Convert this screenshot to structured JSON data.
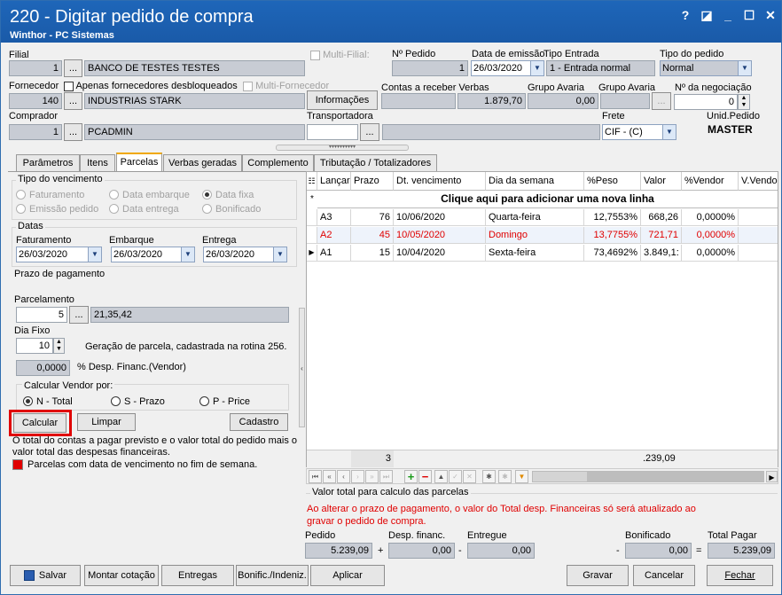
{
  "window": {
    "title": "220 - Digitar pedido de compra",
    "subtitle": "Winthor - PC Sistemas",
    "help": "?",
    "min": "_",
    "max": "☐",
    "close": "✕",
    "restore": "◪"
  },
  "header": {
    "filial_label": "Filial",
    "filial_code": "1",
    "filial_name": "BANCO DE TESTES TESTES",
    "multi_filial": "Multi-Filial:",
    "num_pedido_label": "Nº Pedido",
    "num_pedido": "1",
    "data_emissao_label": "Data de emissão",
    "data_emissao": "26/03/2020",
    "tipo_entrada_label": "Tipo Entrada",
    "tipo_entrada": "1 - Entrada normal",
    "tipo_pedido_label": "Tipo do pedido",
    "tipo_pedido": "Normal",
    "fornecedor_label": "Fornecedor",
    "apenas_desbloq": "Apenas fornecedores desbloqueados",
    "multi_fornecedor": "Multi-Fornecedor",
    "fornecedor_code": "140",
    "fornecedor_name": "INDUSTRIAS STARK",
    "informacoes": "Informações",
    "contas_receber_label": "Contas a receber Verbas",
    "contas_receber": "1.879,70",
    "grupo_avaria1_label": "Grupo Avaria",
    "grupo_avaria1": "0,00",
    "grupo_avaria2_label": "Grupo Avaria",
    "num_negociacao_label": "Nº da negociação",
    "num_negociacao": "0",
    "comprador_label": "Comprador",
    "comprador_code": "1",
    "comprador_name": "PCADMIN",
    "transportadora_label": "Transportadora",
    "frete_label": "Frete",
    "frete": "CIF - (C)",
    "unid_pedido_label": "Unid.Pedido",
    "unid_pedido": "MASTER",
    "ellipsis": "..."
  },
  "tabs": [
    "Parâmetros",
    "Itens",
    "Parcelas",
    "Verbas geradas",
    "Complemento",
    "Tributação / Totalizadores"
  ],
  "left": {
    "tipo_venc_label": "Tipo do vencimento",
    "radios": [
      "Faturamento",
      "Data embarque",
      "Data fixa",
      "Emissão pedido",
      "Data entrega",
      "Bonificado"
    ],
    "datas_label": "Datas",
    "faturamento_label": "Faturamento",
    "faturamento": "26/03/2020",
    "embarque_label": "Embarque",
    "embarque": "26/03/2020",
    "entrega_label": "Entrega",
    "entrega": "26/03/2020",
    "prazo_label": "Prazo de pagamento",
    "parcelamento_label": "Parcelamento",
    "parcelamento": "5",
    "parcelamento_desc": "21,35,42",
    "dia_fixo_label": "Dia Fixo",
    "dia_fixo": "10",
    "geracao_info": "Geração de parcela, cadastrada na rotina 256.",
    "desp_financ": "0,0000",
    "desp_financ_label": "% Desp. Financ.(Vendor)",
    "calc_vendor_label": "Calcular Vendor por:",
    "calc_options": [
      "N - Total",
      "S - Prazo",
      "P - Price"
    ],
    "calcular": "Calcular",
    "limpar": "Limpar",
    "cadastro": "Cadastro",
    "warning": "O total do contas a pagar previsto e o valor total do pedido mais o valor total das despesas financeiras.",
    "legend": "Parcelas com data de vencimento no fim de semana.",
    "legend_color": "#e00000"
  },
  "grid": {
    "columns": [
      "Lançar",
      "Prazo",
      "Dt. vencimento",
      "Dia da semana",
      "%Peso",
      "Valor",
      "%Vendor",
      "V.Vendor"
    ],
    "add_row": "Clique aqui para adicionar uma nova linha",
    "rows": [
      {
        "lancar": "A3",
        "prazo": "76",
        "venc": "10/06/2020",
        "dia": "Quarta-feira",
        "peso": "12,7553%",
        "valor": "668,26",
        "vendor": "0,0000%",
        "red": false
      },
      {
        "lancar": "A2",
        "prazo": "45",
        "venc": "10/05/2020",
        "dia": "Domingo",
        "peso": "13,7755%",
        "valor": "721,71",
        "vendor": "0,0000%",
        "red": true
      },
      {
        "lancar": "A1",
        "prazo": "15",
        "venc": "10/04/2020",
        "dia": "Sexta-feira",
        "peso": "73,4692%",
        "valor": "3.849,1:",
        "vendor": "0,0000%",
        "red": false
      }
    ],
    "footer_count": "3",
    "footer_total": ".239,09"
  },
  "totals": {
    "group_label": "Valor total para calculo das parcelas",
    "alert": "Ao alterar o prazo de pagamento, o valor do Total desp. Financeiras só será atualizado ao gravar o pedido de compra.",
    "pedido_label": "Pedido",
    "pedido": "5.239,09",
    "desp_label": "Desp. financ.",
    "desp": "0,00",
    "entregue_label": "Entregue",
    "entregue": "0,00",
    "bonificado_label": "Bonificado",
    "bonificado": "0,00",
    "total_label": "Total Pagar",
    "total": "5.239,09",
    "plus": "+",
    "minus1": "-",
    "minus2": "-",
    "eq": "="
  },
  "bottom": {
    "salvar": "Salvar",
    "montar": "Montar cotação",
    "entregas": "Entregas",
    "bonific": "Bonific./Indeniz.",
    "aplicar": "Aplicar",
    "gravar": "Gravar",
    "cancelar": "Cancelar",
    "fechar": "Fechar"
  }
}
